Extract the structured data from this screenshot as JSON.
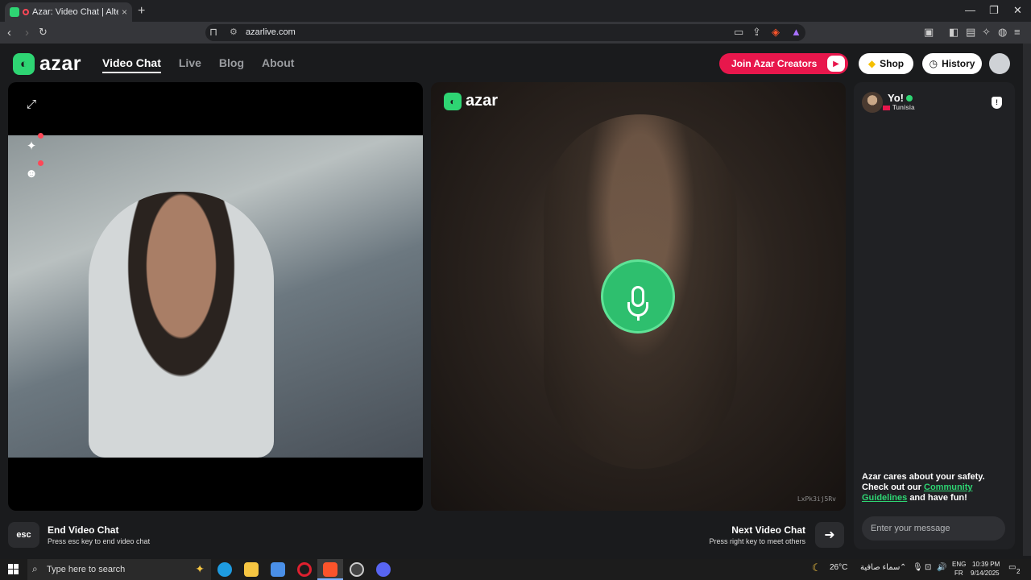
{
  "browser": {
    "tab_title": "Azar: Video Chat | Alternative",
    "tab_close": "×",
    "new_tab": "+",
    "url": "azarlive.com",
    "window_controls": [
      "—",
      "❐",
      "✕"
    ]
  },
  "site": {
    "logo_text": "azar",
    "nav": [
      "Video Chat",
      "Live",
      "Blog",
      "About"
    ],
    "join_creators_label": "Join Azar Creators",
    "shop_label": "Shop",
    "history_label": "History"
  },
  "right_pane": {
    "logo_text": "azar",
    "user_code": "LxPk3ij5Rv"
  },
  "chat": {
    "peer_name": "Yo!",
    "peer_country": "Tunisia",
    "report_icon": "!",
    "safety_line1": "Azar cares about your safety.",
    "safety_line2": "Check out our",
    "safety_link": "Community Guidelines",
    "safety_line3": "and have fun!",
    "message_placeholder": "Enter your message"
  },
  "controls": {
    "esc_key": "esc",
    "end_title": "End Video Chat",
    "end_sub": "Press esc key to end video chat",
    "next_title": "Next Video Chat",
    "next_sub": "Press right key to meet others"
  },
  "taskbar": {
    "search_placeholder": "Type here to search",
    "weather_temp": "26°C",
    "weather_text": "سماء صافية",
    "lang_1": "ENG",
    "lang_2": "FR",
    "time": "10:39 PM",
    "date": "9/14/2025",
    "notif_count": "2"
  },
  "colors": {
    "brand_green": "#2ed573",
    "creators_red": "#e8174c",
    "background": "#1a1b1d"
  },
  "icons": [
    "fullscreen-icon",
    "sparkle-effects-icon",
    "emoji-mask-icon",
    "microphone-icon",
    "shield-report-icon",
    "arrow-right-icon",
    "gem-icon",
    "clock-icon",
    "user-icon",
    "play-icon"
  ]
}
